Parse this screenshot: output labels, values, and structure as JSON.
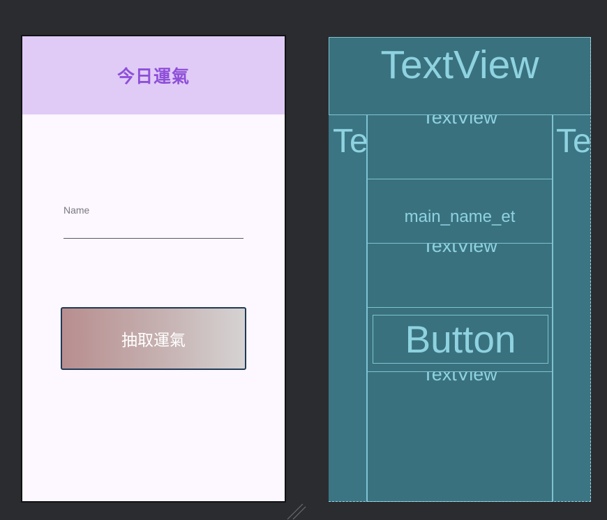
{
  "design": {
    "header_title": "今日運氣",
    "name_hint": "Name",
    "draw_button_label": "抽取運氣"
  },
  "blueprint": {
    "header_label": "TextView",
    "left_label": "Te",
    "right_label": "Te",
    "textview_top_label": "TextView",
    "name_edit_label": "main_name_et",
    "textview_mid_label": "TextView",
    "button_label": "Button",
    "textview_bottom_label": "TextView"
  },
  "colors": {
    "canvas_bg": "#2b2c30",
    "header_bg": "#e0cbf6",
    "header_text": "#8e4fd9",
    "blueprint_bg": "#39717f",
    "blueprint_line": "#7fc3d2"
  }
}
